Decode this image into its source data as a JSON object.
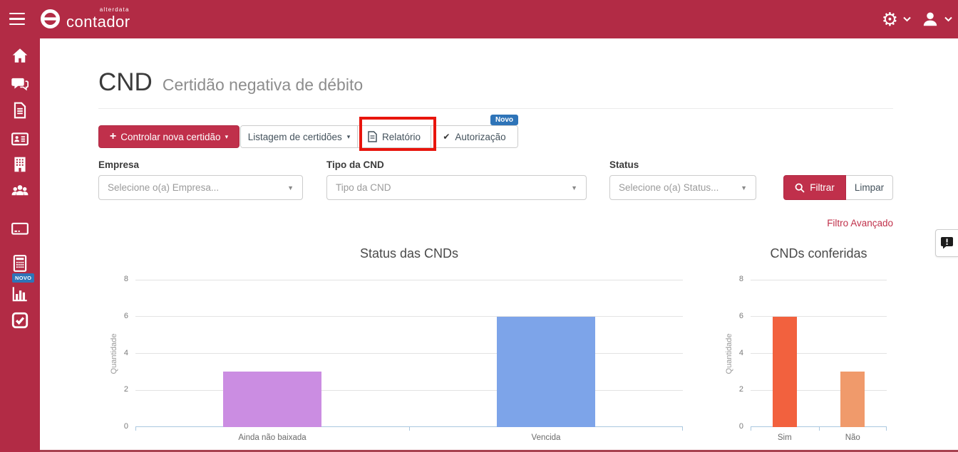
{
  "topbar": {
    "brand_small": "alterdata",
    "brand": "contador"
  },
  "sidebar": {
    "novo_badge": "NOVO",
    "items": [
      "home",
      "chat",
      "document",
      "id-card",
      "building",
      "users",
      "credit-card",
      "calculator",
      "bar-chart",
      "check-square"
    ]
  },
  "page": {
    "title": "CND",
    "subtitle": "Certidão negativa de débito"
  },
  "toolbar": {
    "new_certificate": "Controlar nova certidão",
    "listing": "Listagem de certidões",
    "report": "Relatório",
    "authorization": "Autorização",
    "novo_badge": "Novo"
  },
  "filters": {
    "empresa_label": "Empresa",
    "empresa_placeholder": "Selecione o(a) Empresa...",
    "tipo_label": "Tipo da CND",
    "tipo_placeholder": "Tipo da CND",
    "status_label": "Status",
    "status_placeholder": "Selecione o(a) Status...",
    "filter_button": "Filtrar",
    "clear_button": "Limpar",
    "advanced_link": "Filtro Avançado"
  },
  "icons": {
    "gear": "⚙",
    "plus": "+",
    "caret_down": "▾",
    "select_caret": "▼",
    "check": "✔"
  },
  "colors": {
    "brand_red": "#b22b45",
    "button_red": "#c0304b",
    "novo_blue": "#2e74b8",
    "link_red": "#c0304a",
    "annotation_red": "#e8150d",
    "axis_blue": "#aac8df"
  },
  "chart_data": [
    {
      "type": "bar",
      "title": "Status das CNDs",
      "ylabel": "Quantidade",
      "xlabel": "",
      "categories": [
        "Ainda não baixada",
        "Vencida"
      ],
      "values": [
        3,
        6
      ],
      "bar_colors": [
        "#cb8de2",
        "#7da4e9"
      ],
      "ylim": [
        0,
        8
      ],
      "yticks": [
        0,
        2,
        4,
        6,
        8
      ],
      "grid": true,
      "legend": false
    },
    {
      "type": "bar",
      "title": "CNDs conferidas",
      "ylabel": "Quantidade",
      "xlabel": "",
      "categories": [
        "Sim",
        "Não"
      ],
      "values": [
        6,
        3
      ],
      "bar_colors": [
        "#f2613e",
        "#f09a6b"
      ],
      "ylim": [
        0,
        8
      ],
      "yticks": [
        0,
        2,
        4,
        6,
        8
      ],
      "grid": true,
      "legend": false
    }
  ]
}
